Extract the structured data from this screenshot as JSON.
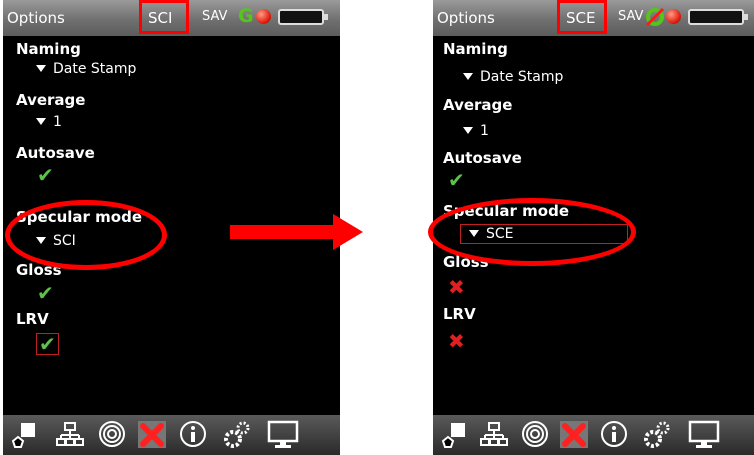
{
  "left_screen": {
    "title": "Options",
    "mode": "SCI",
    "sav": "SAV",
    "status_g": "G",
    "settings": {
      "naming_label": "Naming",
      "naming_value": "Date Stamp",
      "average_label": "Average",
      "average_value": "1",
      "autosave_label": "Autosave",
      "autosave_state": "checked",
      "specular_label": "Specular mode",
      "specular_value": "SCI",
      "gloss_label": "Gloss",
      "gloss_state": "checked",
      "lrv_label": "LRV",
      "lrv_state": "checked"
    }
  },
  "right_screen": {
    "title": "Options",
    "mode": "SCE",
    "sav": "SAV",
    "settings": {
      "naming_label": "Naming",
      "naming_value": "Date Stamp",
      "average_label": "Average",
      "average_value": "1",
      "autosave_label": "Autosave",
      "autosave_state": "checked",
      "specular_label": "Specular mode",
      "specular_value": "SCE",
      "gloss_label": "Gloss",
      "gloss_state": "unchecked",
      "lrv_label": "LRV",
      "lrv_state": "unchecked"
    }
  },
  "bottom_icons": [
    "shapes-icon",
    "hierarchy-icon",
    "target-icon",
    "tools-icon",
    "info-icon",
    "gears-icon",
    "monitor-icon"
  ],
  "colors": {
    "highlight": "#ff0000",
    "check": "#5ec24a",
    "cross": "#e02020",
    "status_g": "#55c51a"
  }
}
